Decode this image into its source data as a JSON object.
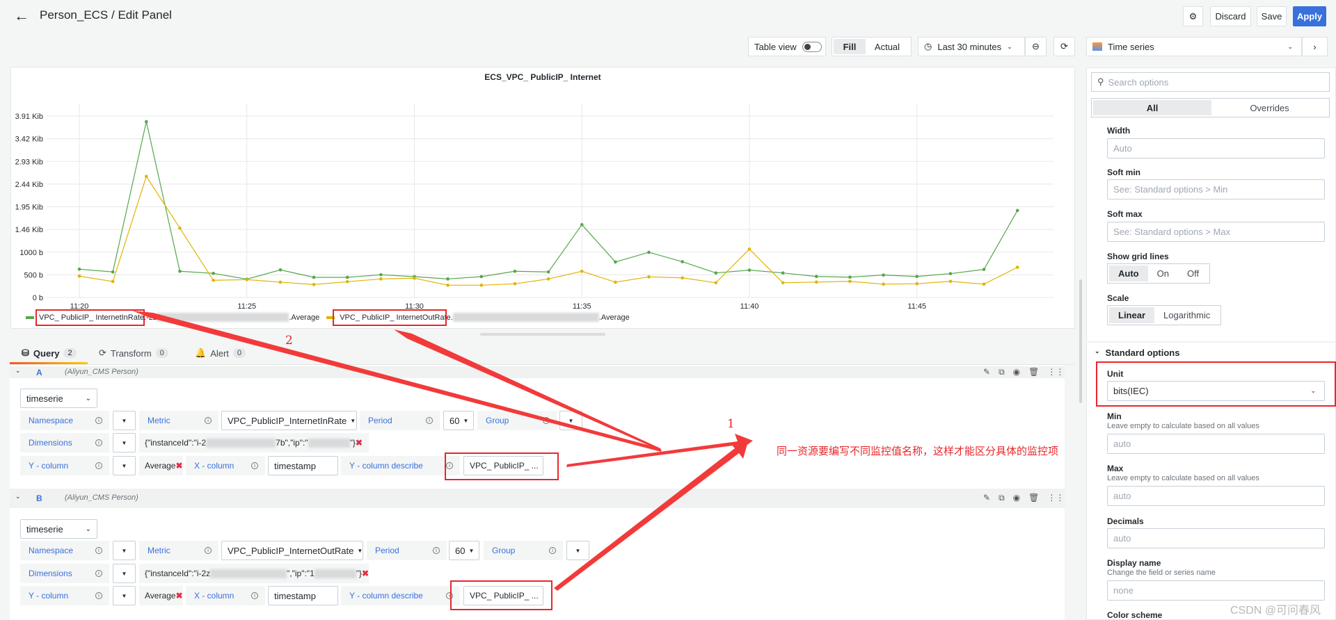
{
  "header": {
    "title": "Person_ECS / Edit Panel",
    "discard": "Discard",
    "save": "Save",
    "apply": "Apply"
  },
  "toolbar": {
    "table_view": "Table view",
    "fill": "Fill",
    "actual": "Actual",
    "time_range": "Last 30 minutes",
    "viz": "Time series"
  },
  "chart_data": {
    "type": "line",
    "title": "ECS_VPC_ PublicIP_ Internet",
    "x": [
      "11:20",
      "11:21",
      "11:22",
      "11:23",
      "11:24",
      "11:25",
      "11:26",
      "11:27",
      "11:28",
      "11:29",
      "11:30",
      "11:31",
      "11:32",
      "11:33",
      "11:34",
      "11:35",
      "11:36",
      "11:37",
      "11:38",
      "11:39",
      "11:40",
      "11:41",
      "11:42",
      "11:43",
      "11:44",
      "11:45",
      "11:46",
      "11:47",
      "11:48"
    ],
    "x_ticks": [
      "11:20",
      "11:25",
      "11:30",
      "11:35",
      "11:40",
      "11:45"
    ],
    "y_ticks": [
      {
        "value": 0,
        "label": "0 b"
      },
      {
        "value": 500,
        "label": "500 b"
      },
      {
        "value": 1000,
        "label": "1000 b"
      },
      {
        "value": 1500,
        "label": "1.46 Kib"
      },
      {
        "value": 2000,
        "label": "1.95 Kib"
      },
      {
        "value": 2500,
        "label": "2.44 Kib"
      },
      {
        "value": 3000,
        "label": "2.93 Kib"
      },
      {
        "value": 3500,
        "label": "3.42 Kib"
      },
      {
        "value": 4000,
        "label": "3.91 Kib"
      }
    ],
    "ylim": [
      0,
      4000
    ],
    "unit": "bits(IEC)",
    "grid": true,
    "legend": "bottom-left",
    "series": [
      {
        "name": "VPC_ PublicIP_ InternetInRate.",
        "color": "#56a64b",
        "values": [
          624,
          563,
          3877,
          578,
          532,
          404,
          609,
          445,
          445,
          501,
          460,
          409,
          460,
          578,
          563,
          1606,
          783,
          997,
          789,
          541,
          603,
          541,
          464,
          448,
          495,
          464,
          526,
          619,
          1918
        ]
      },
      {
        "name": "VPC_ PublicIP_ InternetOutRate",
        "color": "#e0b400",
        "values": [
          471,
          353,
          2670,
          1529,
          379,
          394,
          338,
          286,
          348,
          409,
          425,
          271,
          271,
          302,
          409,
          578,
          338,
          455,
          433,
          325,
          1067,
          325,
          340,
          356,
          294,
          304,
          356,
          294,
          665
        ]
      }
    ]
  },
  "legend": {
    "in_suffix_visible": "-2z",
    "in_end": ".Average",
    "out_suffix_visible": ".",
    "out_end": ".Average"
  },
  "tabs": [
    {
      "label": "Query",
      "count": "2"
    },
    {
      "label": "Transform",
      "count": "0"
    },
    {
      "label": "Alert",
      "count": "0"
    }
  ],
  "queries": [
    {
      "ref": "A",
      "datasource": "(Aliyun_CMS Person)",
      "type": "timeserie",
      "metric": "VPC_PublicIP_InternetInRate",
      "period": "60",
      "dimensions_start": "{\"instanceId\":\"i-2",
      "dimensions_mid": "7b\",\"ip\":\"",
      "dimensions_end": "\"}",
      "ycol": "Average",
      "xcol": "timestamp",
      "ydesc": "VPC_ PublicIP_ ..."
    },
    {
      "ref": "B",
      "datasource": "(Aliyun_CMS Person)",
      "type": "timeserie",
      "metric": "VPC_PublicIP_InternetOutRate",
      "period": "60",
      "dimensions_start": "{\"instanceId\":\"i-2z",
      "dimensions_mid": "\",\"ip\":\"1",
      "dimensions_end": "\"}",
      "ycol": "Average",
      "xcol": "timestamp",
      "ydesc": "VPC_ PublicIP_ ..."
    }
  ],
  "qlabels": {
    "namespace": "Namespace",
    "metric": "Metric",
    "period": "Period",
    "group": "Group",
    "dimensions": "Dimensions",
    "ycol": "Y - column",
    "xcol": "X - column",
    "ydesc": "Y - column describe"
  },
  "options": {
    "search_placeholder": "Search options",
    "all": "All",
    "overrides": "Overrides",
    "width_label": "Width",
    "width_ph": "Auto",
    "softmin_label": "Soft min",
    "softmin_ph": "See: Standard options > Min",
    "softmax_label": "Soft max",
    "softmax_ph": "See: Standard options > Max",
    "grid_label": "Show grid lines",
    "grid_opts": [
      "Auto",
      "On",
      "Off"
    ],
    "scale_label": "Scale",
    "scale_opts": [
      "Linear",
      "Logarithmic"
    ],
    "standard": "Standard options",
    "unit_label": "Unit",
    "unit_value": "bits(IEC)",
    "min_label": "Min",
    "min_desc": "Leave empty to calculate based on all values",
    "min_ph": "auto",
    "max_label": "Max",
    "max_desc": "Leave empty to calculate based on all values",
    "max_ph": "auto",
    "decimals_label": "Decimals",
    "decimals_ph": "auto",
    "display_label": "Display name",
    "display_desc": "Change the field or series name",
    "display_ph": "none",
    "color_scheme": "Color scheme"
  },
  "annotations": {
    "n1": "1",
    "n2": "2",
    "note": "同一资源要编写不同监控值名称，这样才能区分具体的监控项",
    "accent": "#e8262b"
  },
  "watermark": "CSDN @可问春风"
}
